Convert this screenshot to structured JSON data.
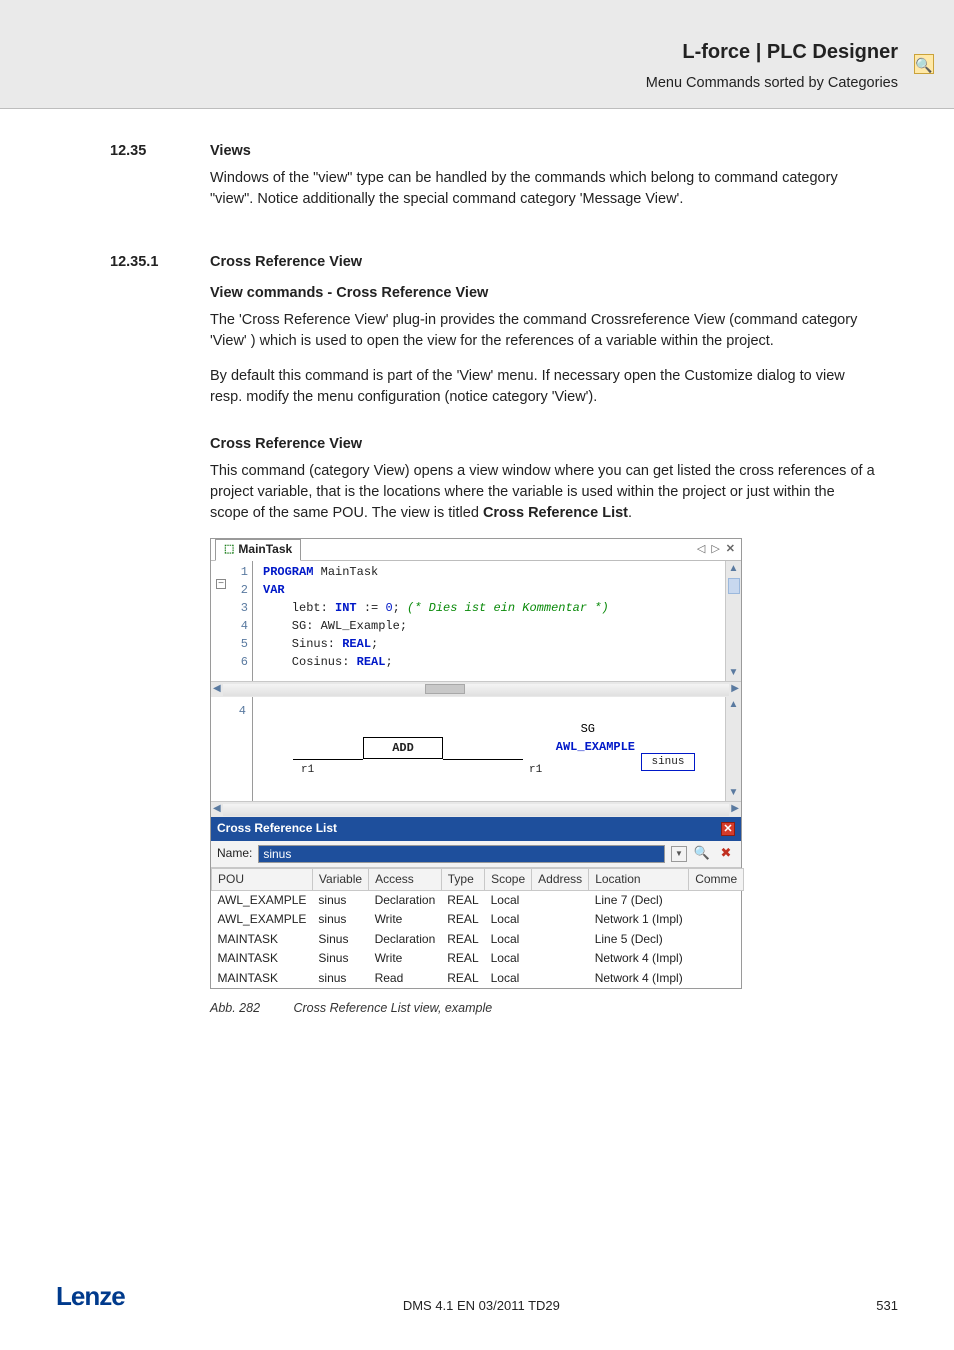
{
  "header": {
    "title": "L-force | PLC Designer",
    "subtitle": "Menu Commands sorted by Categories"
  },
  "sections": {
    "s1_num": "12.35",
    "s1_title": "Views",
    "s1_p1": "Windows of the \"view\" type can be handled by the commands which belong to command category \"view\". Notice additionally the special command category 'Message View'.",
    "s2_num": "12.35.1",
    "s2_title": "Cross Reference View",
    "s2_h": "View commands - Cross Reference View",
    "s2_p1": "The 'Cross Reference View' plug-in provides the command Crossreference View (command category 'View' ) which is used to open the view for the references of a variable within the project.",
    "s2_p2": "By default this command is part of the 'View' menu. If necessary open the Customize dialog to view resp. modify the menu configuration (notice category 'View').",
    "s3_h": "Cross Reference View",
    "s3_p1a": "This command (category View) opens a view window where you can get listed the cross references of a project variable, that is the locations where the variable is used within the project or just within the scope of the same POU. The view is titled ",
    "s3_p1b": "Cross Reference List",
    "s3_p1c": "."
  },
  "editor": {
    "tab": "MainTask",
    "gutter": [
      "1",
      "2",
      "3",
      "4",
      "5",
      "6"
    ],
    "l1a": "PROGRAM",
    "l1b": " MainTask",
    "l2": "VAR",
    "l3a": "    lebt: ",
    "l3b": "INT",
    "l3c": " := ",
    "l3d": "0",
    "l3e": "; ",
    "l3f": "(* Dies ist ein Kommentar *)",
    "l4": "    SG: AWL_Example;",
    "l5a": "    Sinus: ",
    "l5b": "REAL",
    "l5c": ";",
    "l6a": "    Cosinus: ",
    "l6b": "REAL",
    "l6c": ";",
    "diag_gutter": "4",
    "sg": "SG",
    "awl": "AWL_EXAMPLE",
    "add": "ADD",
    "r1": "r1",
    "sinus": "sinus"
  },
  "crl": {
    "title": "Cross Reference List",
    "name_label": "Name:",
    "name_value": "sinus",
    "cols": [
      "POU",
      "Variable",
      "Access",
      "Type",
      "Scope",
      "Address",
      "Location",
      "Comme"
    ],
    "rows": [
      {
        "pou": "AWL_EXAMPLE",
        "var": "sinus",
        "acc": "Declaration",
        "type": "REAL",
        "scope": "Local",
        "addr": "",
        "loc": "Line 7 (Decl)"
      },
      {
        "pou": "AWL_EXAMPLE",
        "var": "sinus",
        "acc": "Write",
        "type": "REAL",
        "scope": "Local",
        "addr": "",
        "loc": "Network 1 (Impl)"
      },
      {
        "pou": "MAINTASK",
        "var": "Sinus",
        "acc": "Declaration",
        "type": "REAL",
        "scope": "Local",
        "addr": "",
        "loc": "Line 5 (Decl)"
      },
      {
        "pou": "MAINTASK",
        "var": "Sinus",
        "acc": "Write",
        "type": "REAL",
        "scope": "Local",
        "addr": "",
        "loc": "Network 4 (Impl)"
      },
      {
        "pou": "MAINTASK",
        "var": "sinus",
        "acc": "Read",
        "type": "REAL",
        "scope": "Local",
        "addr": "",
        "loc": "Network 4 (Impl)"
      }
    ]
  },
  "figure": {
    "num": "Abb. 282",
    "text": "Cross Reference List view, example"
  },
  "footer": {
    "logo": "Lenze",
    "mid": "DMS 4.1 EN 03/2011 TD29",
    "page": "531"
  }
}
